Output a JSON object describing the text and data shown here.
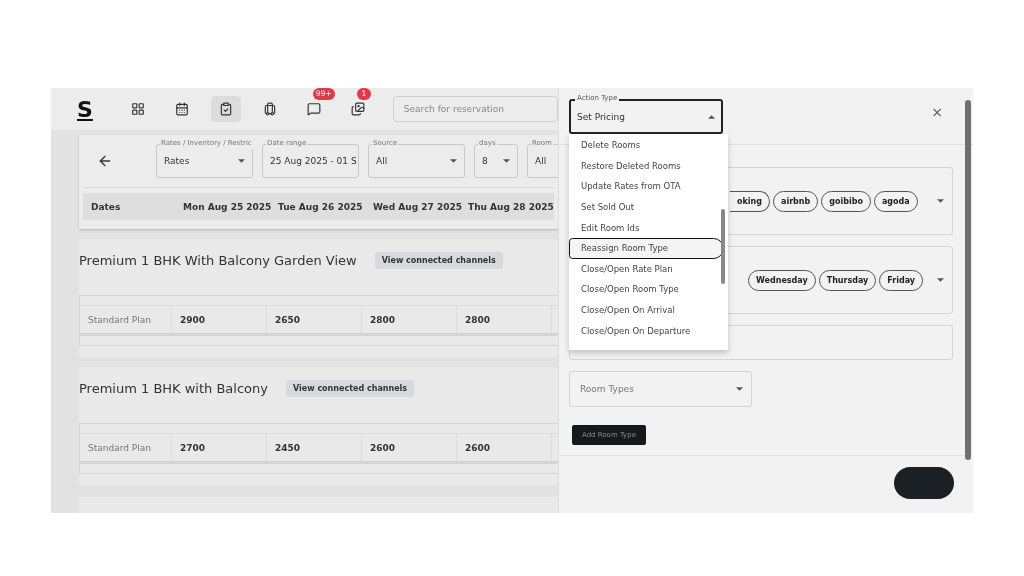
{
  "top_bar": {
    "logo": "S",
    "nav": [
      {
        "kind": "grid",
        "selected": false
      },
      {
        "kind": "calendar",
        "selected": false
      },
      {
        "kind": "clipboard",
        "selected": true
      },
      {
        "kind": "luggage",
        "selected": false
      },
      {
        "kind": "chat",
        "selected": false,
        "badge": "99+"
      },
      {
        "kind": "image",
        "selected": false,
        "badge": "1"
      }
    ],
    "search": {
      "placeholder": "Search for reservation"
    }
  },
  "filters": [
    {
      "label": "Rates / Inventory / Restric",
      "value": "Rates",
      "dropdown": true
    },
    {
      "label": "Date range",
      "value": "25 Aug 2025 - 01 S",
      "dropdown": false
    },
    {
      "label": "Source",
      "value": "All",
      "dropdown": true
    },
    {
      "label": "days",
      "value": "8",
      "dropdown": true
    },
    {
      "label": "Room",
      "value": "All",
      "dropdown": false
    }
  ],
  "dates_header": {
    "label": "Dates",
    "dates": [
      "Mon Aug 25 2025",
      "Tue Aug 26 2025",
      "Wed Aug 27 2025",
      "Thu Aug 28 2025"
    ]
  },
  "rooms": [
    {
      "name": "Premium 1 BHK With Balcony Garden View",
      "button": "View connected channels",
      "plan": "Standard Plan",
      "rates": [
        "2900",
        "2650",
        "2800",
        "2800"
      ]
    },
    {
      "name": "Premium 1 BHK with Balcony",
      "button": "View connected channels",
      "plan": "Standard Plan",
      "rates": [
        "2700",
        "2450",
        "2600",
        "2600"
      ]
    }
  ],
  "drawer": {
    "action_type": {
      "label": "Action Type",
      "value": "Set Pricing",
      "expanded": true,
      "options": [
        {
          "label": "Delete Rooms",
          "selected": false
        },
        {
          "label": "Restore Deleted Rooms",
          "selected": false
        },
        {
          "label": "Update Rates from OTA",
          "selected": false
        },
        {
          "label": "Set Sold Out",
          "selected": false
        },
        {
          "label": "Edit Room Ids",
          "selected": false
        },
        {
          "label": "Reassign Room Type",
          "selected": true
        },
        {
          "label": "Close/Open Rate Plan",
          "selected": false
        },
        {
          "label": "Close/Open Room Type",
          "selected": false
        },
        {
          "label": "Close/Open On Arrival",
          "selected": false
        },
        {
          "label": "Close/Open On Departure",
          "selected": false
        }
      ]
    },
    "close": "×",
    "channels": [
      "oking",
      "airbnb",
      "goibibo",
      "agoda"
    ],
    "days": [
      "Wednesday",
      "Thursday",
      "Friday"
    ],
    "room_types": {
      "placeholder": "Room Types"
    },
    "add_button": "Add Room Type"
  }
}
